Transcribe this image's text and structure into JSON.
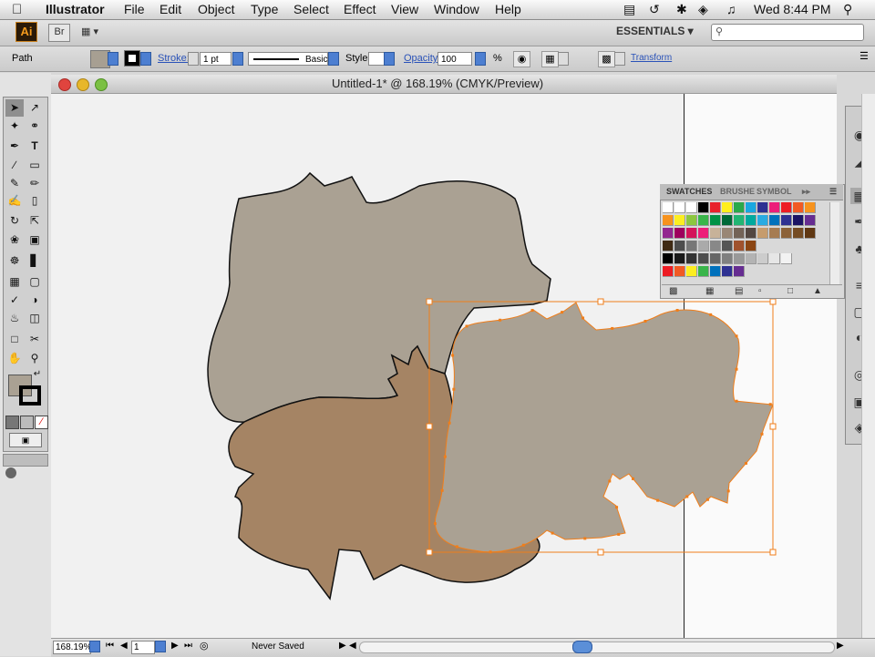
{
  "menubar": {
    "apple": "",
    "app_name": "Illustrator",
    "items": [
      "File",
      "Edit",
      "Object",
      "Type",
      "Select",
      "Effect",
      "View",
      "Window",
      "Help"
    ],
    "clock": "Wed 8:44 PM"
  },
  "appbar": {
    "logo": "Ai",
    "bridge": "Br",
    "arrange": "▦ ▾",
    "workspace": "ESSENTIALS ▾",
    "search_placeholder": ""
  },
  "control": {
    "object_type": "Path",
    "stroke_label": "Stroke:",
    "stroke_weight": "1 pt",
    "brush_name": "Basic",
    "style_label": "Style:",
    "opacity_label": "Opacity:",
    "opacity_value": "100",
    "opacity_unit": "%",
    "transform_label": "Transform",
    "fill_color": "#a79f92",
    "stroke_color": "#000000"
  },
  "document": {
    "title": "Untitled-1* @ 168.19% (CMYK/Preview)",
    "shapes": [
      {
        "name": "gray-silhouette",
        "fill": "#aaa193"
      },
      {
        "name": "brown-silhouette",
        "fill": "#a58464"
      },
      {
        "name": "selected-gray-silhouette",
        "fill": "#aaa193"
      }
    ],
    "selection_color": "#f07e1a"
  },
  "status": {
    "zoom": "168.19%",
    "page": "1",
    "save_state": "Never Saved"
  },
  "swatches_panel": {
    "tabs": [
      "SWATCHES",
      "BRUSHE",
      "SYMBOL"
    ],
    "rows": [
      [
        "#ffffff",
        "#ffffff",
        "#ffffff",
        "#000000",
        "#e8212b",
        "#ffef1c",
        "#2aa94a",
        "#1aa7e0",
        "#2e3192",
        "#ec1e79",
        "#ed1c24",
        "#f15a24",
        "#f7931e"
      ],
      [
        "#f7931e",
        "#fcee21",
        "#8cc63f",
        "#39b54a",
        "#009245",
        "#006837",
        "#22b573",
        "#00a99d",
        "#29abe2",
        "#0071bc",
        "#2e3192",
        "#1b1464",
        "#662d91"
      ],
      [
        "#93278f",
        "#9e005d",
        "#d4145a",
        "#ed1e79",
        "#c7b299",
        "#998675",
        "#736357",
        "#534741",
        "#c69c6d",
        "#a67c52",
        "#8c6239",
        "#754c24",
        "#603813"
      ],
      [
        "#3f2a14",
        "#4d4d4d",
        "#777777",
        "#aaaaaa",
        "#888888",
        "#555555",
        "#a0522d",
        "#8b4513"
      ],
      [
        "#000000",
        "#1a1a1a",
        "#333333",
        "#4d4d4d",
        "#666666",
        "#808080",
        "#999999",
        "#b3b3b3",
        "#cccccc",
        "#e6e6e6",
        "#f2f2f2"
      ],
      [
        "#ed1c24",
        "#f15a24",
        "#fcee21",
        "#39b54a",
        "#0071bc",
        "#2e3192",
        "#662d91"
      ]
    ]
  }
}
